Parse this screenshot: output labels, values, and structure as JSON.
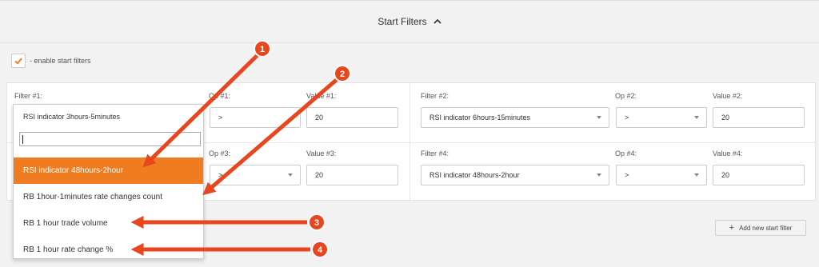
{
  "header": {
    "title": "Start Filters",
    "chevron_icon": "chevron-up-icon"
  },
  "enable": {
    "checked": true,
    "label": "- enable start filters",
    "accent": "#f07c21"
  },
  "filters": {
    "f1": {
      "label": "Filter #1:",
      "value": "RSI indicator 3hours-5minutes"
    },
    "op1": {
      "label": "Op #1:",
      "value": ">"
    },
    "v1": {
      "label": "Value #1:",
      "value": "20"
    },
    "f2": {
      "label": "Filter #2:",
      "value": "RSI indicator 6hours-15minutes"
    },
    "op2": {
      "label": "Op #2:",
      "value": ">"
    },
    "v2": {
      "label": "Value #2:",
      "value": "20"
    },
    "op3": {
      "label": "Op #3:",
      "value": ">"
    },
    "v3": {
      "label": "Value #3:",
      "value": "20"
    },
    "f4": {
      "label": "Filter #4:",
      "value": "RSI indicator 48hours-2hour"
    },
    "op4": {
      "label": "Op #4:",
      "value": ">"
    },
    "v4": {
      "label": "Value #4:",
      "value": "20"
    }
  },
  "dropdown": {
    "search_value": "",
    "options": [
      {
        "label": "RSI indicator 48hours-2hour",
        "active": true
      },
      {
        "label": "RB 1hour-1minutes rate changes count",
        "active": false
      },
      {
        "label": "RB 1 hour trade volume",
        "active": false
      },
      {
        "label": "RB 1 hour rate change %",
        "active": false
      }
    ]
  },
  "add_button": {
    "label": "Add new start filter"
  },
  "annotations": {
    "color": "#e8461e",
    "badges": [
      "1",
      "2",
      "3",
      "4"
    ]
  }
}
